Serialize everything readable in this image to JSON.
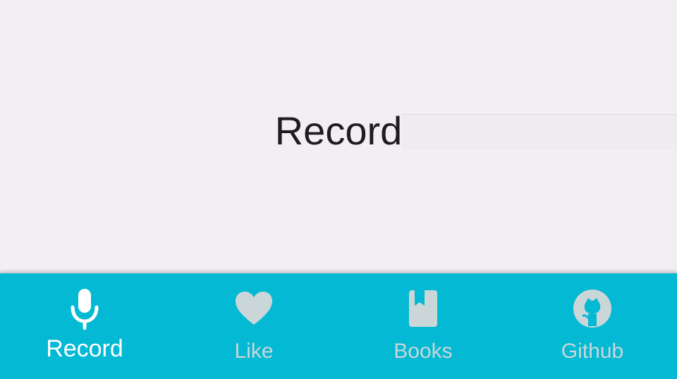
{
  "main": {
    "title": "Record"
  },
  "bottom_nav": {
    "items": [
      {
        "label": "Record",
        "icon": "microphone-icon",
        "active": true
      },
      {
        "label": "Like",
        "icon": "heart-icon",
        "active": false
      },
      {
        "label": "Books",
        "icon": "book-icon",
        "active": false
      },
      {
        "label": "Github",
        "icon": "github-icon",
        "active": false
      }
    ]
  },
  "colors": {
    "background": "#f2eef2",
    "nav_bar": "#04b9d3",
    "active_icon": "#ffffff",
    "inactive_icon": "#cbd6d8",
    "title_text": "#1f1b1f"
  }
}
